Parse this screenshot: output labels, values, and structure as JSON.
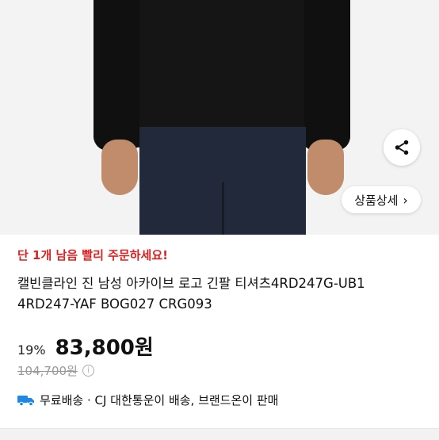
{
  "hero": {
    "share_icon": "share-icon",
    "detail_button": {
      "label": "상품상세",
      "icon": "chevron-right-icon",
      "chevron": "›"
    }
  },
  "product": {
    "stock_notice": "단 1개 남음 빨리 주문하세요!",
    "title": "캘빈클라인 진 남성 아카이브 로고 긴팔 티셔츠4RD247G-UB1 4RD247-YAF BOG027 CRG093",
    "discount": "19%",
    "price": "83,800원",
    "original_price": "104,700원",
    "info_icon": "i"
  },
  "shipping": {
    "icon": "truck-icon",
    "text": "무료배송 · CJ 대한통운이 배송, 브랜드온이 판매"
  },
  "colors": {
    "stock_red": "#e02020",
    "truck_blue": "#1e88e5"
  }
}
